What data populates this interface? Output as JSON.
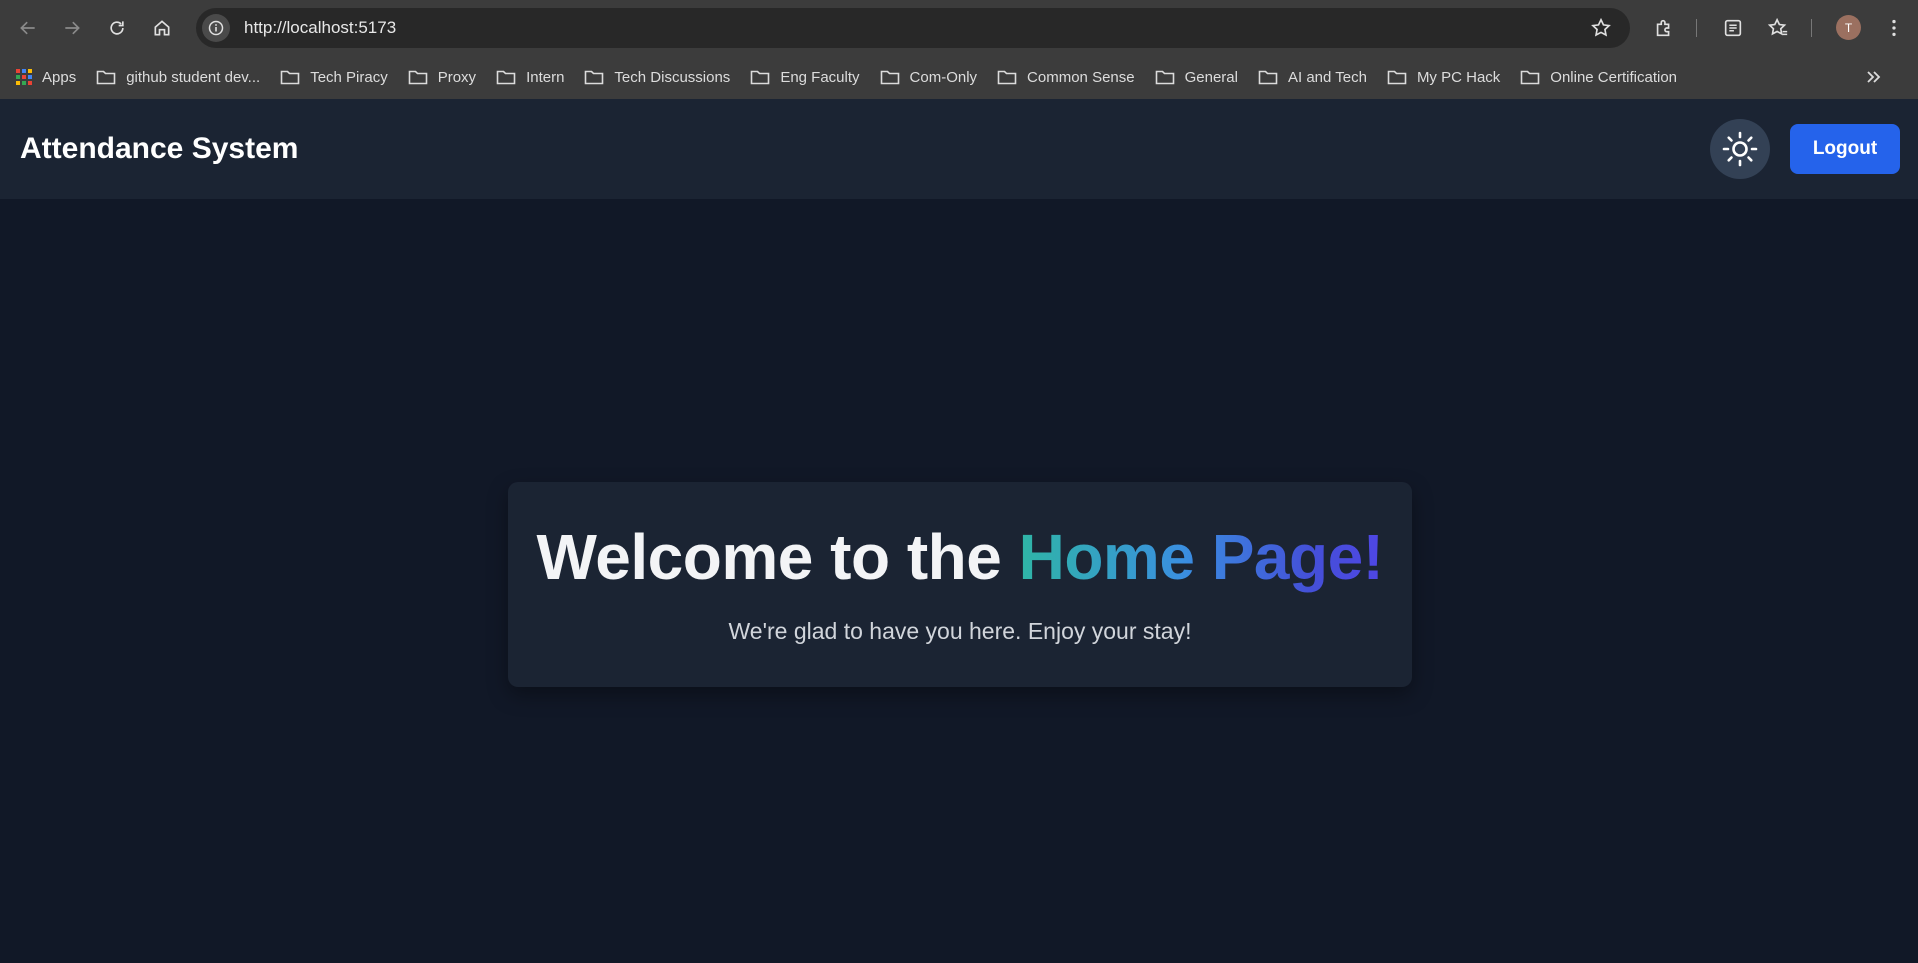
{
  "browser": {
    "url": "http://localhost:5173",
    "bookmarks": [
      {
        "label": "Apps",
        "icon": "apps-grid-icon"
      },
      {
        "label": "github student dev...",
        "icon": "folder-icon"
      },
      {
        "label": "Tech Piracy",
        "icon": "folder-icon"
      },
      {
        "label": "Proxy",
        "icon": "folder-icon"
      },
      {
        "label": "Intern",
        "icon": "folder-icon"
      },
      {
        "label": "Tech Discussions",
        "icon": "folder-icon"
      },
      {
        "label": "Eng Faculty",
        "icon": "folder-icon"
      },
      {
        "label": "Com-Only",
        "icon": "folder-icon"
      },
      {
        "label": "Common Sense",
        "icon": "folder-icon"
      },
      {
        "label": "General",
        "icon": "folder-icon"
      },
      {
        "label": "AI and Tech",
        "icon": "folder-icon"
      },
      {
        "label": "My PC Hack",
        "icon": "folder-icon"
      },
      {
        "label": "Online Certification",
        "icon": "folder-icon"
      }
    ],
    "profile_initial": "T"
  },
  "app": {
    "title": "Attendance System",
    "logout_label": "Logout",
    "theme_icon": "sun-icon"
  },
  "welcome": {
    "heading_plain": "Welcome to the ",
    "heading_highlight": "Home Page!",
    "subtext": "We're glad to have you here. Enjoy your stay!"
  },
  "colors": {
    "page_bg": "#111827",
    "header_bg": "#1b2433",
    "accent_button": "#2563eb",
    "gradient_start": "#2fb5a6",
    "gradient_end": "#4f46e5"
  }
}
